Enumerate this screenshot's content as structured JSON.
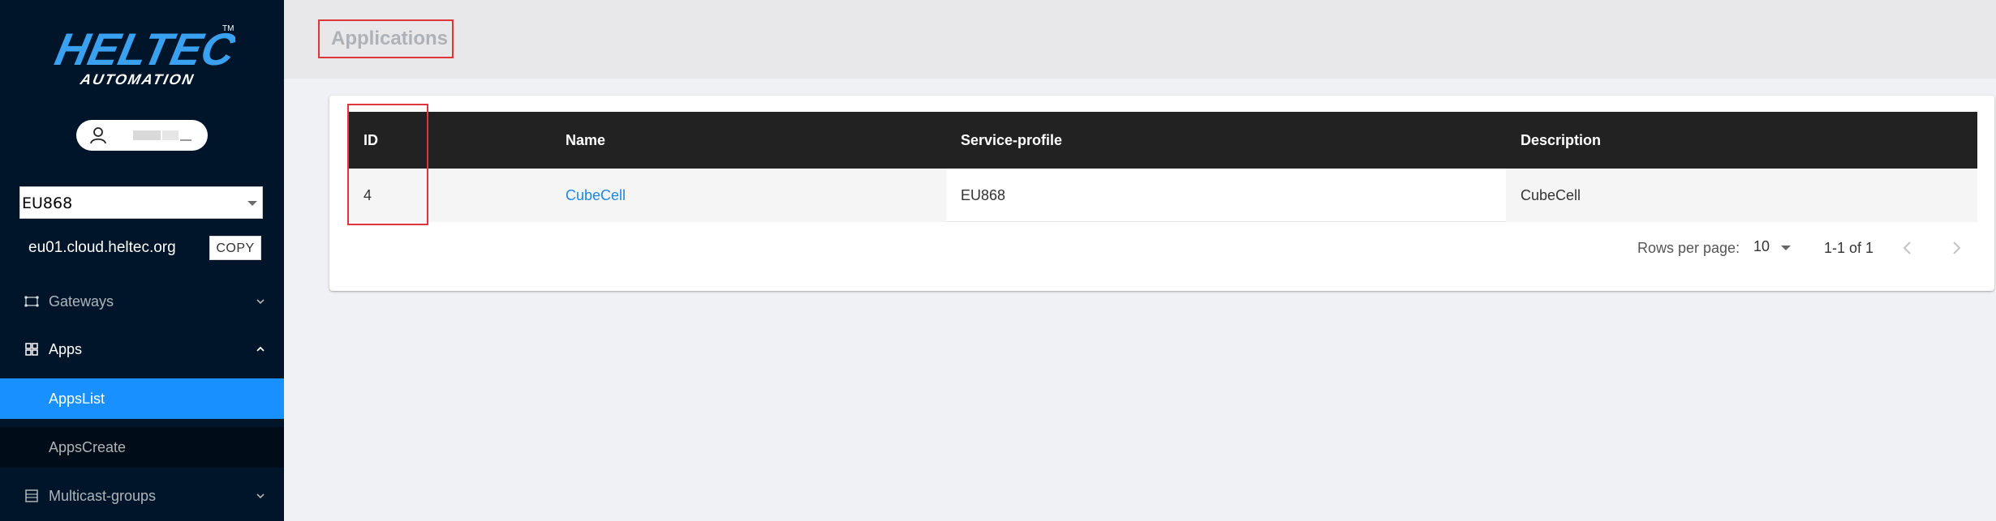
{
  "brand": {
    "logo_text": "HELTEC",
    "logo_sub": "AUTOMATION",
    "trademark": "TM"
  },
  "user": {
    "icon": "user-icon"
  },
  "region": {
    "selected": "EU868"
  },
  "server": {
    "url": "eu01.cloud.heltec.org",
    "copy_label": "COPY"
  },
  "nav": {
    "gateways": {
      "label": "Gateways",
      "icon": "gateway-icon"
    },
    "apps": {
      "label": "Apps",
      "icon": "apps-grid-icon"
    },
    "apps_list": {
      "label": "AppsList"
    },
    "apps_create": {
      "label": "AppsCreate"
    },
    "multicast": {
      "label": "Multicast-groups",
      "icon": "multicast-icon"
    }
  },
  "page": {
    "title": "Applications"
  },
  "table": {
    "columns": [
      "ID",
      "Name",
      "Service-profile",
      "Description"
    ],
    "rows": [
      {
        "id": "4",
        "name": "CubeCell",
        "service_profile": "EU868",
        "description": "CubeCell"
      }
    ]
  },
  "pagination": {
    "rows_per_page_label": "Rows per page:",
    "rows_per_page_value": "10",
    "range": "1-1 of 1"
  },
  "colors": {
    "sidebar_bg": "#001529",
    "active_item": "#1890ff",
    "highlight_box": "#e0353b",
    "link": "#1e88e5",
    "table_header": "#222222"
  }
}
